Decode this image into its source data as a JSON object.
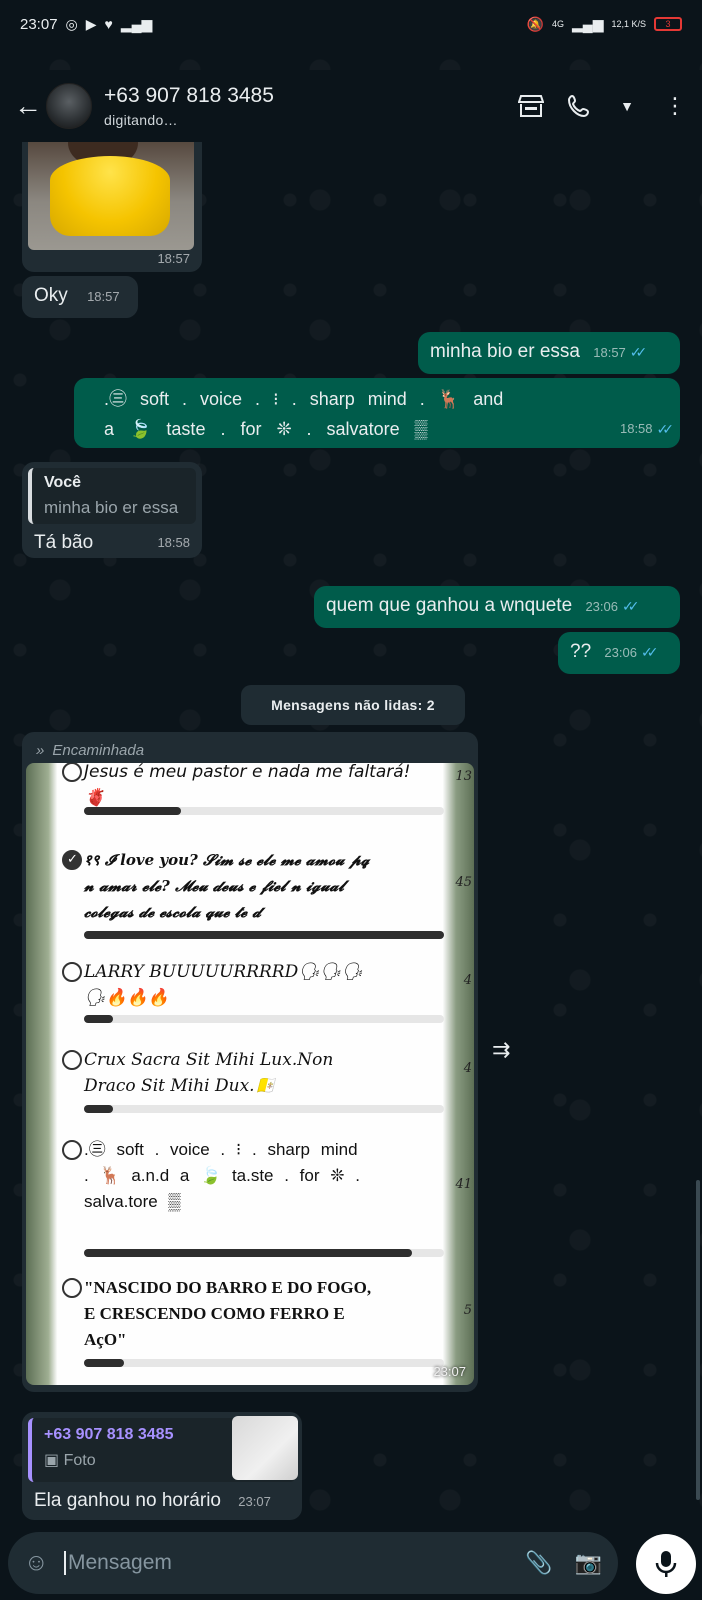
{
  "status_bar": {
    "time": "23:07",
    "network": "4G",
    "speed": "12,1 K/S",
    "battery": "3"
  },
  "header": {
    "contact_name": "+63 907 818 3485",
    "contact_status": "digitando…"
  },
  "messages": [
    {
      "id": "photo",
      "direction": "in",
      "time": "18:57"
    },
    {
      "id": "oky",
      "direction": "in",
      "text": "Oky",
      "time": "18:57"
    },
    {
      "id": "bio1",
      "direction": "out",
      "text": "minha bio er essa",
      "time": "18:57"
    },
    {
      "id": "bio2",
      "direction": "out",
      "text_line1": ".㊂ soft . voice . ⁝ . sharp mind . 🦌 and",
      "text_line2": "a 🍃 taste . for ❊ . salvatore ▒",
      "time": "18:58"
    },
    {
      "id": "reply1",
      "direction": "in",
      "quote_author": "Você",
      "quote_text": "minha bio er essa",
      "text": "Tá bão",
      "time": "18:58"
    },
    {
      "id": "q1",
      "direction": "out",
      "text": "quem que ganhou a wnquete",
      "time": "23:06"
    },
    {
      "id": "q2",
      "direction": "out",
      "text": "??",
      "time": "23:06"
    }
  ],
  "unread_divider": "Mensagens não lidas: 2",
  "forwarded": {
    "label": "Encaminhada",
    "time": "23:07",
    "poll_options": [
      {
        "text": "Jesus é meu pastor e nada me faltará! 🫀",
        "count": "13",
        "fraction": 0.27,
        "checked": false
      },
      {
        "text": "१९ 𝓘 love you? 𝓢𝓲𝓶 𝓼𝓮 𝓮𝓵𝓮 𝓶𝓮 𝓪𝓶𝓸𝓾 𝓹𝓺 𝓷 𝓪𝓶𝓪𝓻 𝓮𝓵𝓮? 𝓜𝓮𝓾 𝓭𝓮𝓾𝓼 𝓮 𝓯𝓲𝓮𝓵 𝓷 𝓲𝓰𝓾𝓪𝓵 𝓬𝓸𝓵𝓮𝓰𝓪𝓼 𝓭𝓮 𝓮𝓼𝓬𝓸𝓵𝓪 𝓺𝓾𝓮 𝓽𝓮 𝓭",
        "count": "45",
        "fraction": 1.0,
        "checked": true
      },
      {
        "text": "LARRY BUUUUURRRRD🗣🗣🗣🗣🔥🔥🔥",
        "count": "4",
        "fraction": 0.08,
        "checked": false
      },
      {
        "text": "Crux Sacra Sit Mihi Lux.Non Draco Sit Mihi Dux.🇻🇦",
        "count": "4",
        "fraction": 0.08,
        "checked": false
      },
      {
        "text": ".㊂ soft . voice . ⁝ . sharp mind . 🦌 a.n.d a 🍃 ta.ste . for ❊ . salva.tore ▒",
        "count": "41",
        "fraction": 0.91,
        "checked": false
      },
      {
        "text": "\"NASCIDO DO BARRO E DO FOGO, E CRESCENDO COMO FERRO E AçO\"",
        "count": "5",
        "fraction": 0.11,
        "checked": false
      }
    ]
  },
  "reply_last": {
    "quote_author": "+63 907 818 3485",
    "quote_type": "Foto",
    "text": "Ela ganhou no horário",
    "time": "23:07"
  },
  "input": {
    "placeholder": "Mensagem"
  },
  "colors": {
    "background": "#0b141a",
    "incoming_bubble": "#202c33",
    "outgoing_bubble": "#005c4b",
    "read_ticks": "#53bdeb"
  }
}
